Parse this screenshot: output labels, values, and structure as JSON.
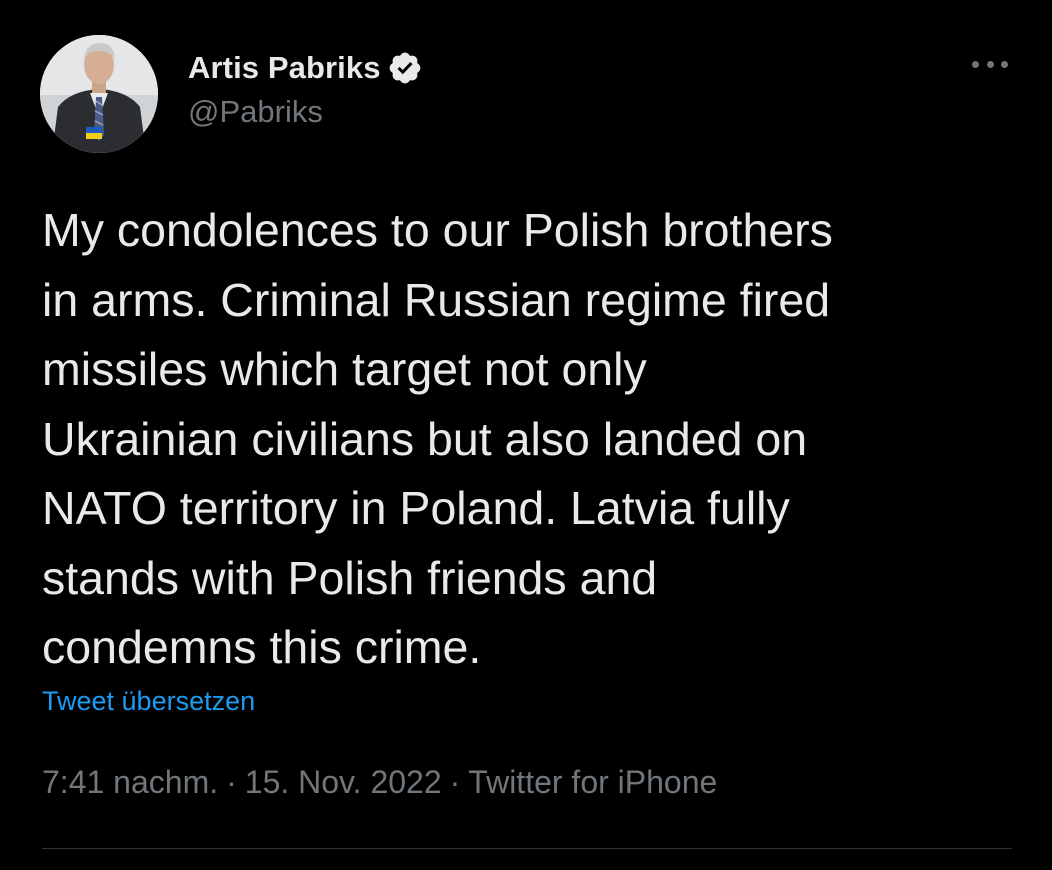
{
  "author": {
    "display_name": "Artis Pabriks",
    "handle": "@Pabriks",
    "verified": true,
    "avatar_icon": "profile-photo"
  },
  "tweet": {
    "text": "My condolences to our Polish brothers\nin arms. Criminal Russian regime fired\nmissiles which target not only\nUkrainian civilians but also landed on\nNATO territory in Poland. Latvia fully\nstands with Polish friends and\ncondemns this crime.",
    "translate_label": "Tweet übersetzen",
    "time": "7:41 nachm.",
    "date": "15. Nov. 2022",
    "source": "Twitter for iPhone",
    "separator": "·"
  },
  "colors": {
    "background": "#000000",
    "text": "#e7e9ea",
    "secondary": "#71767b",
    "link": "#1d9bf0",
    "divider": "#2f3336"
  },
  "icons": {
    "more": "more-options-icon",
    "verified": "verified-badge-icon"
  }
}
